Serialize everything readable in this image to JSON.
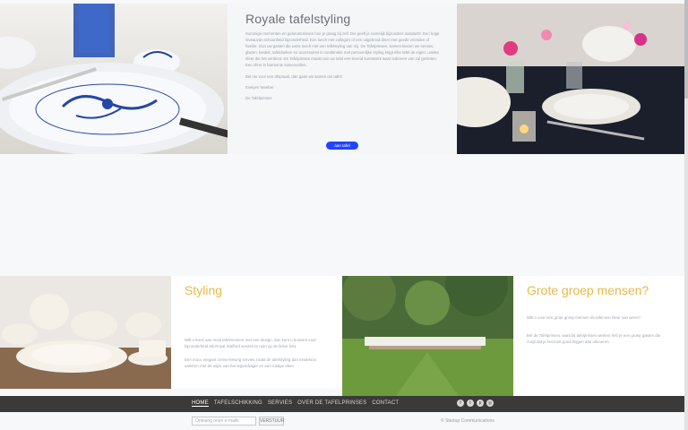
{
  "hero": {
    "title": "Royale tafelstyling",
    "paragraphs": [
      "Sommige momenten en gebeurtenissen hoe je graag bij zelf. Die geeft je namelijk bijzondere aandacht. Een hoge niveauvan schoonheid bijzonderheid. Een lunch met collega's of een uitgebreid diner met goede vrienden of familie. Gun uw gasten die extra touch met een tafelstyling van mij. De Tafelprinses. Samen kiezen we servies, glazen, bestek, tafeldoeken en accessoires in combinatie met persoonlijke styling krijgt elke tafel de eigen, unieke sfeer die het verdient. De Tafelprinses maakt van uw tafel een levend kunstwerk waar iedereen van zal genieten. Een sfeer in harmonie samenvallen.",
      "Bel me voor een afspraak, dan gaan we samen om tafel!",
      "Evelyen Weeber",
      "De Tafelprinses"
    ],
    "cta_label": "aan tafel"
  },
  "styling": {
    "title": "Styling",
    "paragraphs": [
      "Wilt u feest aan mooi tafelmoment met een design, dan kunt u bouwen voor bijzonderheid als Royal Stafford servies te ruim op de linker foto.",
      "Een mooi, elegant creme-kleurig servies zodat de tafelstyling dan eindeloos variëren met de wijze van het tegendrager en een rustige sfeer."
    ]
  },
  "group": {
    "title": "Grote groep mensen?",
    "paragraphs": [
      "Wilt u voor een grote groep mensen de tafel een kleur van wens?",
      "Bel de Tafelprinses, want bij tafelprinses werken heb je een groep gasten die zorgt dat je het kunt goed krijgen aan uitvoeren."
    ]
  },
  "nav": {
    "items": [
      "HOME",
      "TAFELSCHIKKING",
      "SERVIES",
      "OVER DE TAFELPRINSES",
      "CONTACT"
    ]
  },
  "socials": [
    "facebook-icon",
    "twitter-icon",
    "pinterest-icon",
    "instagram-icon"
  ],
  "footer": {
    "newsletter_placeholder": "Ontvang onze e-mails",
    "newsletter_button": "VERSTUUR",
    "copyright": "© Startup Communications"
  },
  "colors": {
    "accent_blue": "#2145ff",
    "accent_yellow": "#e6b94a",
    "nav_bg": "#3a3a3a"
  }
}
